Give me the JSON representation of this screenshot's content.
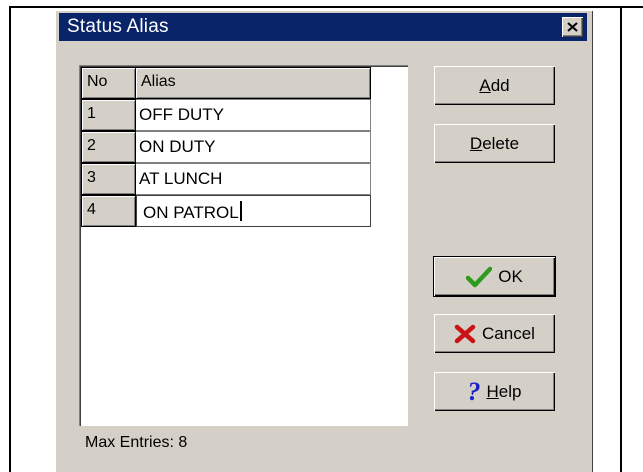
{
  "window": {
    "title": "Status Alias"
  },
  "grid": {
    "headers": {
      "no": "No",
      "alias": "Alias"
    },
    "rows": [
      {
        "no": "1",
        "alias": "OFF DUTY"
      },
      {
        "no": "2",
        "alias": "ON DUTY"
      },
      {
        "no": "3",
        "alias": "AT LUNCH"
      },
      {
        "no": "4",
        "alias": "ON PATROL"
      }
    ]
  },
  "buttons": {
    "add": {
      "mnemonic": "A",
      "rest": "dd"
    },
    "delete": {
      "mnemonic": "D",
      "rest": "elete"
    },
    "ok": {
      "label": "OK"
    },
    "cancel": {
      "label": "Cancel"
    },
    "help": {
      "mnemonic": "H",
      "rest": "elp"
    }
  },
  "status": {
    "text": "Max Entries: 8"
  },
  "colors": {
    "titlebar": "#0a246a",
    "face": "#d4d0c8",
    "ok_check": "#2e9b1e",
    "cancel_x": "#c81414",
    "help_q": "#1a22c8"
  }
}
